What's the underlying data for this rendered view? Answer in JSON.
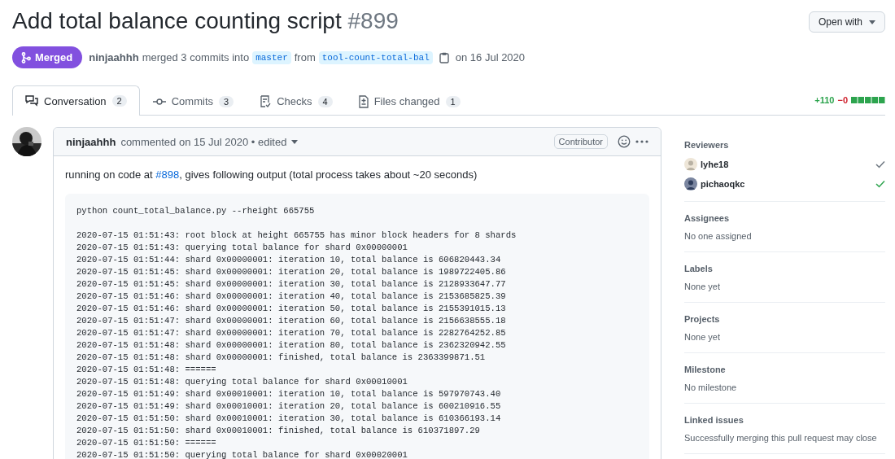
{
  "header": {
    "title": "Add total balance counting script",
    "number": "#899",
    "open_with": "Open with"
  },
  "status": {
    "merged": true,
    "label": "Merged",
    "author": "ninjaahhh",
    "action": "merged 3 commits into",
    "base": "master",
    "from": "from",
    "head": "tool-count-total-bal",
    "date": "on 16 Jul 2020"
  },
  "tabs": [
    {
      "label": "Conversation",
      "count": "2",
      "selected": true
    },
    {
      "label": "Commits",
      "count": "3",
      "selected": false
    },
    {
      "label": "Checks",
      "count": "4",
      "selected": false
    },
    {
      "label": "Files changed",
      "count": "1",
      "selected": false
    }
  ],
  "diffstat": {
    "additions": "+110",
    "deletions": "−0"
  },
  "comment": {
    "author": "ninjaahhh",
    "meta": "commented on 15 Jul 2020 • edited",
    "badge": "Contributor",
    "text_before": "running on code at ",
    "link": "#898",
    "text_after": ", gives following output (total process takes about ~20 seconds)",
    "command": "python count_total_balance.py --rheight 665755",
    "code": [
      "2020-07-15 01:51:43: root block at height 665755 has minor block headers for 8 shards",
      "2020-07-15 01:51:43: querying total balance for shard 0x00000001",
      "2020-07-15 01:51:44: shard 0x00000001: iteration 10, total balance is 606820443.34",
      "2020-07-15 01:51:45: shard 0x00000001: iteration 20, total balance is 1989722405.86",
      "2020-07-15 01:51:45: shard 0x00000001: iteration 30, total balance is 2128933647.77",
      "2020-07-15 01:51:46: shard 0x00000001: iteration 40, total balance is 2153685825.39",
      "2020-07-15 01:51:46: shard 0x00000001: iteration 50, total balance is 2155391015.13",
      "2020-07-15 01:51:47: shard 0x00000001: iteration 60, total balance is 2156638555.18",
      "2020-07-15 01:51:47: shard 0x00000001: iteration 70, total balance is 2282764252.85",
      "2020-07-15 01:51:48: shard 0x00000001: iteration 80, total balance is 2362320942.55",
      "2020-07-15 01:51:48: shard 0x00000001: finished, total balance is 2363399871.51",
      "2020-07-15 01:51:48: ======",
      "2020-07-15 01:51:48: querying total balance for shard 0x00010001",
      "2020-07-15 01:51:49: shard 0x00010001: iteration 10, total balance is 597970743.40",
      "2020-07-15 01:51:49: shard 0x00010001: iteration 20, total balance is 600210916.55",
      "2020-07-15 01:51:50: shard 0x00010001: iteration 30, total balance is 610366193.14",
      "2020-07-15 01:51:50: shard 0x00010001: finished, total balance is 610371897.29",
      "2020-07-15 01:51:50: ======",
      "2020-07-15 01:51:50: querying total balance for shard 0x00020001"
    ]
  },
  "sidebar": {
    "reviewers_title": "Reviewers",
    "reviewers": [
      {
        "name": "lyhe18",
        "approved": false
      },
      {
        "name": "pichaoqkc",
        "approved": true
      }
    ],
    "sections": [
      {
        "title": "Assignees",
        "value": "No one assigned"
      },
      {
        "title": "Labels",
        "value": "None yet"
      },
      {
        "title": "Projects",
        "value": "None yet"
      },
      {
        "title": "Milestone",
        "value": "No milestone"
      },
      {
        "title": "Linked issues",
        "value": "Successfully merging this pull request may close"
      }
    ]
  }
}
